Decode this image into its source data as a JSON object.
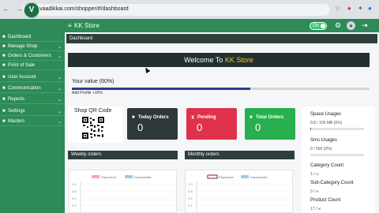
{
  "browser": {
    "url": "e-vaadikkai.com/shopper/#/dashboard"
  },
  "header": {
    "store_name": "KK Store",
    "toggle_label": "On"
  },
  "sidebar": {
    "items": [
      {
        "label": "Dashboard",
        "icon": "dashboard-icon",
        "has_children": false
      },
      {
        "label": "Manage Shop",
        "icon": "shop-icon",
        "has_children": true
      },
      {
        "label": "Orders & Customers",
        "icon": "cart-icon",
        "has_children": true
      },
      {
        "label": "Point of Sale",
        "icon": "pos-icon",
        "has_children": false
      },
      {
        "label": "User Account",
        "icon": "user-icon",
        "has_children": true
      },
      {
        "label": "Communication",
        "icon": "chat-icon",
        "has_children": true
      },
      {
        "label": "Reports",
        "icon": "report-icon",
        "has_children": true
      },
      {
        "label": "Settings",
        "icon": "gear-icon",
        "has_children": true
      },
      {
        "label": "Masters",
        "icon": "list-icon",
        "has_children": true
      }
    ]
  },
  "main": {
    "page_title": "Dashboard",
    "welcome_prefix": "Welcome To",
    "welcome_store": "KK Store",
    "value_label": "Your value (60%)",
    "value_progress": 0.6,
    "profile_note": "Add Profile +10%",
    "qr_title": "Shop QR Code",
    "stats": {
      "today_orders": {
        "label": "Today Orders",
        "value": "0",
        "icon": "bag-icon"
      },
      "pending": {
        "label": "Pending",
        "value": "0",
        "icon": "hourglass-icon"
      },
      "total_orders": {
        "label": "Total Orders",
        "value": "0",
        "icon": "bag-icon"
      }
    },
    "weekly_title": "Weekly orders",
    "monthly_title": "Monthly orders",
    "legend": {
      "series1": "Payconner",
      "series2": "Carconcnter"
    },
    "weekly_axis": [
      "1.0",
      "0.8",
      "0.6",
      "0.4"
    ],
    "monthly_axis": [
      "1.0",
      "0.8",
      "0.6",
      "0.4"
    ],
    "usage": {
      "space_label": "Space Usages",
      "space_value": "0.8 / 100 MB (0%)",
      "space_fraction": 0.008,
      "sms_label": "Sms Usages",
      "sms_value": "0 / 500 (0%)",
      "sms_fraction": 0,
      "category_label": "Category Count",
      "category_value": "1 / ∞",
      "subcategory_label": "Sub-Category Count",
      "subcategory_value": "3 / ∞",
      "product_label": "Product Count",
      "product_value": "17 / ∞"
    }
  },
  "colors": {
    "brand_green": "#2e8b57",
    "dark_header": "#22302f",
    "pending_red": "#e0314b",
    "total_green": "#27b04d",
    "store_accent": "#f4c542",
    "legend_pink": "#f4a6b7",
    "legend_blue": "#9ecae1"
  }
}
